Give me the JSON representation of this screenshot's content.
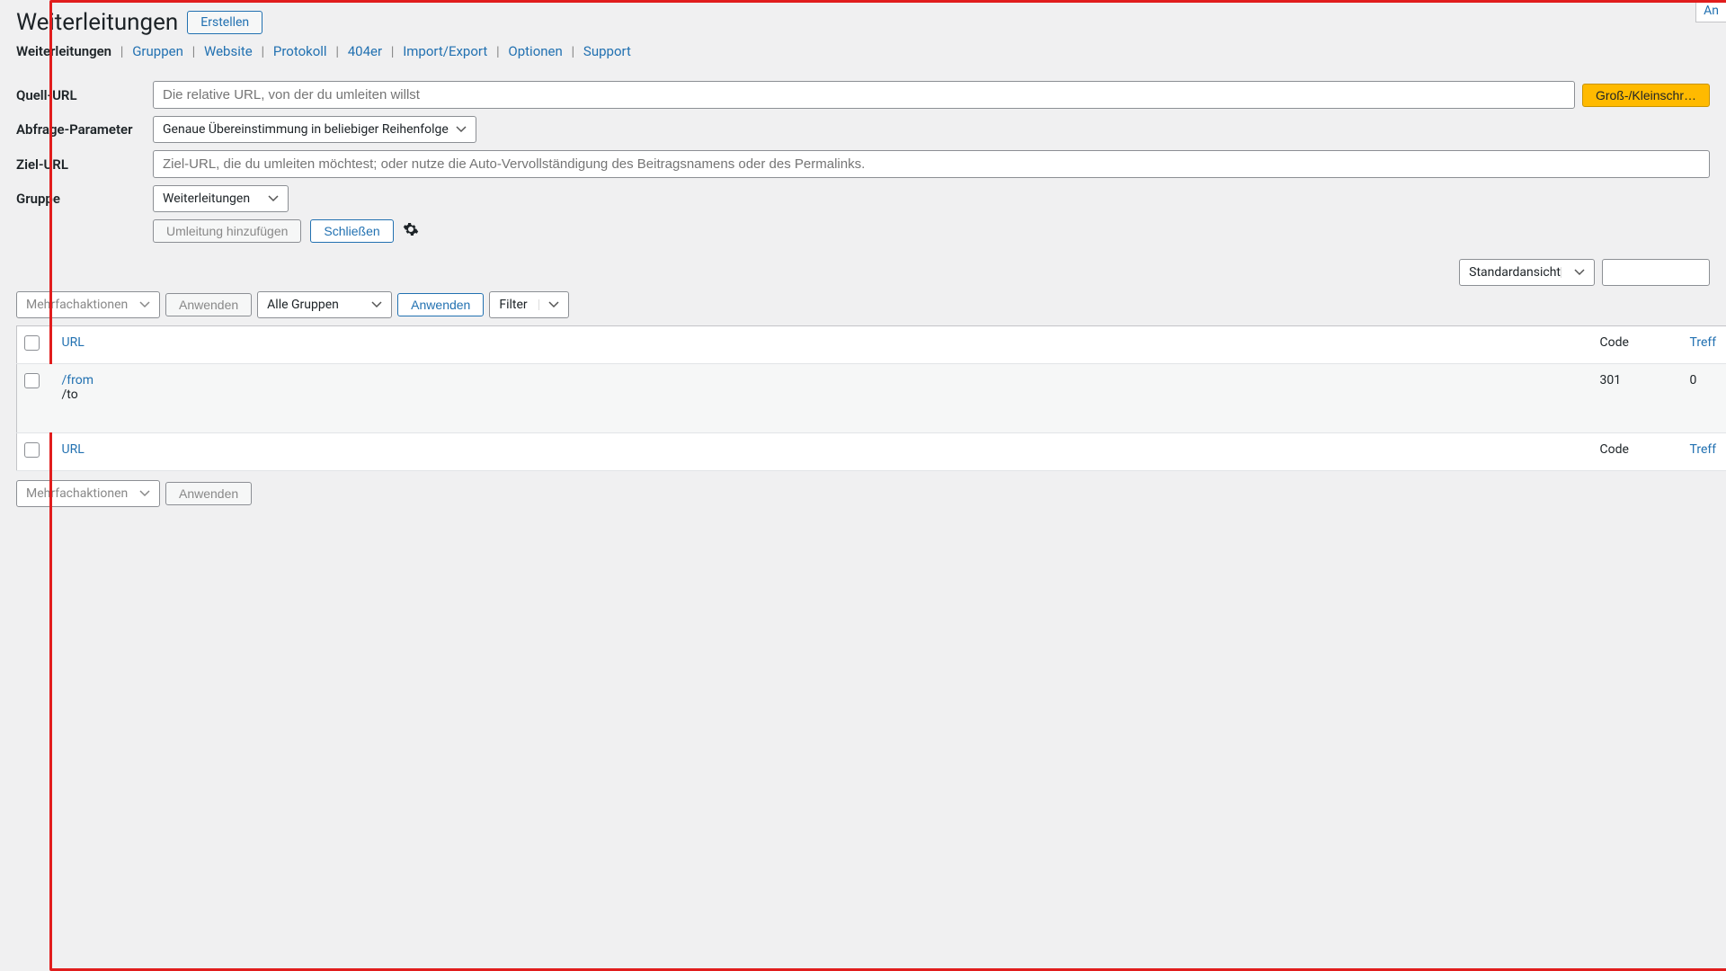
{
  "corner_button": "An",
  "title": "Weiterleitungen",
  "create_button": "Erstellen",
  "tabs": {
    "items": [
      {
        "label": "Weiterleitungen",
        "active": true
      },
      {
        "label": "Gruppen"
      },
      {
        "label": "Website"
      },
      {
        "label": "Protokoll"
      },
      {
        "label": "404er"
      },
      {
        "label": "Import/Export"
      },
      {
        "label": "Optionen"
      },
      {
        "label": "Support"
      }
    ]
  },
  "form": {
    "source_label": "Quell-URL",
    "source_placeholder": "Die relative URL, von der du umleiten willst",
    "case_button": "Groß-/Kleinschr…",
    "query_label": "Abfrage-Parameter",
    "query_value": "Genaue Übereinstimmung in beliebiger Reihenfolge",
    "target_label": "Ziel-URL",
    "target_placeholder": "Ziel-URL, die du umleiten möchtest; oder nutze die Auto-Vervollständigung des Beitragsnamens oder des Permalinks.",
    "group_label": "Gruppe",
    "group_value": "Weiterleitungen",
    "add_button": "Umleitung hinzufügen",
    "close_button": "Schließen"
  },
  "view": {
    "display_value": "Standardansicht"
  },
  "bulk": {
    "actions_label": "Mehrfachaktionen",
    "apply_label": "Anwenden"
  },
  "filter": {
    "group_value": "Alle Gruppen",
    "apply_label": "Anwenden",
    "filter_label": "Filter"
  },
  "columns": {
    "url": "URL",
    "code": "Code",
    "hits": "Treff"
  },
  "rows": [
    {
      "from": "/from",
      "to": "/to",
      "code": "301",
      "hits": "0"
    }
  ]
}
